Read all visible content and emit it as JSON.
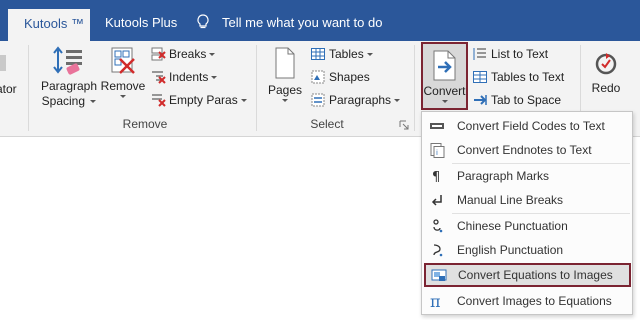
{
  "tabs": {
    "kutools": "Kutools ™",
    "kutools_plus": "Kutools Plus",
    "tell_me": "Tell me what you want to do"
  },
  "ribbon": {
    "cut_label": "ator",
    "paragraph_spacing": {
      "line1": "Paragraph",
      "line2": "Spacing"
    },
    "remove": "Remove",
    "breaks": "Breaks",
    "indents": "Indents",
    "empty_paras": "Empty Paras",
    "remove_group": "Remove",
    "pages": "Pages",
    "tables": "Tables",
    "shapes": "Shapes",
    "paragraphs": "Paragraphs",
    "select_group": "Select",
    "convert": "Convert",
    "list_to_text": "List to Text",
    "tables_to_text": "Tables to Text",
    "tab_to_space": "Tab to Space",
    "redo": "Redo"
  },
  "menu": {
    "items": [
      {
        "label": "Convert Field Codes to Text",
        "icon": "field-codes-icon"
      },
      {
        "label": "Convert Endnotes to Text",
        "icon": "endnotes-icon"
      },
      {
        "label": "Paragraph Marks",
        "icon": "pilcrow-icon"
      },
      {
        "label": "Manual Line Breaks",
        "icon": "line-break-icon"
      },
      {
        "label": "Chinese Punctuation",
        "icon": "chinese-punctuation-icon"
      },
      {
        "label": "English Punctuation",
        "icon": "english-punctuation-icon"
      },
      {
        "label": "Convert Equations to Images",
        "icon": "equation-image-icon"
      },
      {
        "label": "Convert Images to Equations",
        "icon": "pi-icon"
      }
    ]
  },
  "colors": {
    "tabbar": "#2b579a",
    "highlight_border": "#7b2432",
    "ribbon_bg": "#f3f3f3"
  }
}
